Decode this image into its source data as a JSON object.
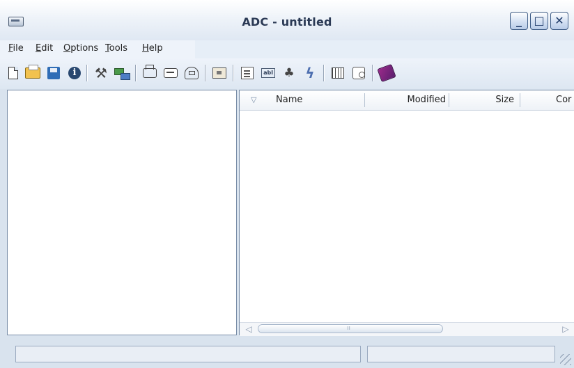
{
  "window": {
    "title": "ADC - untitled"
  },
  "caption_buttons": {
    "minimize": "_",
    "maximize": "□",
    "close": "✕"
  },
  "menu": [
    {
      "accel": "F",
      "rest": "ile"
    },
    {
      "accel": "E",
      "rest": "dit"
    },
    {
      "accel": "O",
      "rest": "ptions"
    },
    {
      "accel": "T",
      "rest": "ools"
    },
    {
      "accel": "H",
      "rest": "elp"
    }
  ],
  "toolbar": {
    "icons": [
      "new-file-icon",
      "open-folder-icon",
      "save-icon",
      "info-icon",
      "tools-icon",
      "network-icon",
      "new-box-icon",
      "tray-icon",
      "disc-icon",
      "folder-box-icon",
      "properties-icon",
      "text-field-icon",
      "users-icon",
      "flash-icon",
      "table-icon",
      "report-icon",
      "book-icon"
    ],
    "text_field_glyph": "abl",
    "info_glyph": "i",
    "tools_glyph": "⚒",
    "users_glyph": "♣",
    "flash_glyph": "ϟ"
  },
  "list": {
    "columns": [
      "Name",
      "Modified",
      "Size",
      "Cor"
    ],
    "sort_glyph": "▽",
    "scroll_left_glyph": "◁",
    "scroll_right_glyph": "▷",
    "thumb_grip": "ıı"
  },
  "status": {
    "left": "",
    "right": ""
  }
}
